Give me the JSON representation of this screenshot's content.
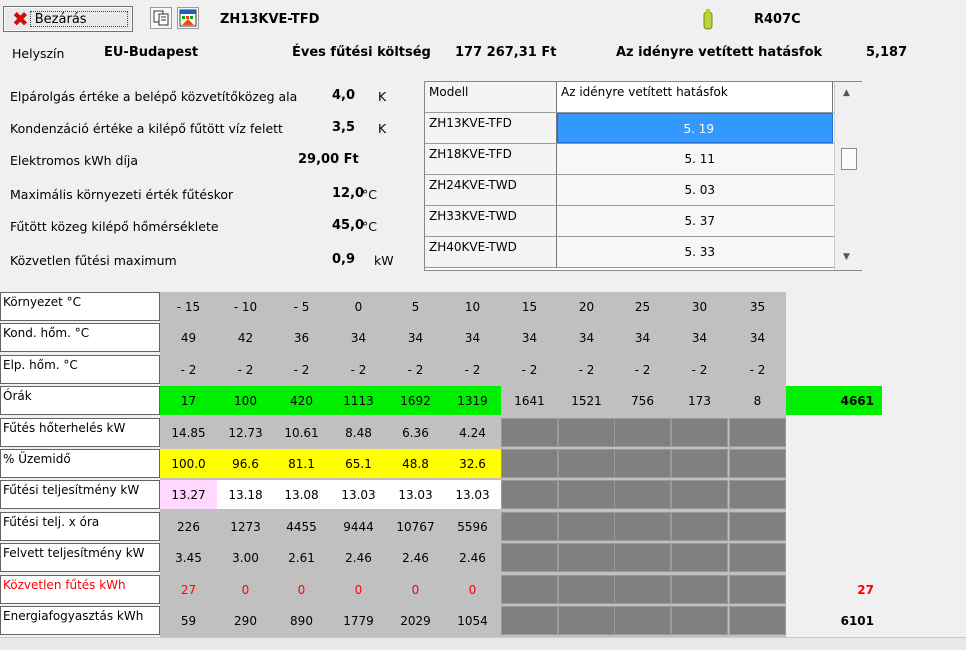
{
  "toolbar": {
    "close_label": "Bezárás",
    "copy_icon": "copy-icon",
    "report_icon": "chart-report-icon",
    "model": "ZH13KVE-TFD",
    "refrigerant_icon": "refrigerant-bottle-icon",
    "refrigerant": "R407C"
  },
  "info": {
    "location_label": "Helyszín",
    "location_value": "EU-Budapest",
    "cost_label": "Éves fűtési költség",
    "cost_value": "177 267,31 Ft",
    "scop_label": "Az idényre vetített hatásfok",
    "scop_value": "5,187"
  },
  "params": [
    {
      "label": "Elpárolgás értéke a belépő közvetítőközeg ala",
      "value": "4,0",
      "unit": "K"
    },
    {
      "label": "Kondenzáció értéke a kilépő fűtött víz felett",
      "value": "3,5",
      "unit": "K"
    },
    {
      "label": "Elektromos kWh díja",
      "value": "29,00 Ft",
      "unit": ""
    },
    {
      "label": "Maximális környezeti érték fűtéskor",
      "value": "12,0",
      "unit": "°C"
    },
    {
      "label": "Fűtött közeg kilépő hőmérséklete",
      "value": "45,0",
      "unit": "°C"
    },
    {
      "label": "Közvetlen fűtési maximum",
      "value": "0,9",
      "unit": "kW"
    }
  ],
  "model_list": {
    "col_model": "Modell",
    "col_scop": "Az idényre vetített hatásfok",
    "rows": [
      {
        "model": "ZH13KVE-TFD",
        "scop": "5. 19"
      },
      {
        "model": "ZH18KVE-TFD",
        "scop": "5. 11"
      },
      {
        "model": "ZH24KVE-TWD",
        "scop": "5. 03"
      },
      {
        "model": "ZH33KVE-TWD",
        "scop": "5. 37"
      },
      {
        "model": "ZH40KVE-TWD",
        "scop": "5. 33"
      }
    ],
    "selected_index": 0
  },
  "table": {
    "rows": [
      {
        "label": "Környezet °C",
        "style": "plain",
        "cells": [
          "- 15",
          "- 10",
          "- 5",
          "0",
          "5",
          "10",
          "15",
          "20",
          "25",
          "30",
          "35"
        ],
        "total": ""
      },
      {
        "label": "Kond. hőm. °C",
        "style": "plain",
        "cells": [
          "49",
          "42",
          "36",
          "34",
          "34",
          "34",
          "34",
          "34",
          "34",
          "34",
          "34"
        ],
        "total": ""
      },
      {
        "label": "Elp. hőm. °C",
        "style": "plain",
        "cells": [
          "- 2",
          "- 2",
          "- 2",
          "- 2",
          "- 2",
          "- 2",
          "- 2",
          "- 2",
          "- 2",
          "- 2",
          "- 2"
        ],
        "total": ""
      },
      {
        "label": "Órák",
        "style": "green",
        "cells": [
          "17",
          "100",
          "420",
          "1113",
          "1692",
          "1319",
          "1641",
          "1521",
          "756",
          "173",
          "8"
        ],
        "total": "4661"
      },
      {
        "label": "Fűtés hőterhelés kW",
        "style": "plain",
        "cells": [
          "14.85",
          "12.73",
          "10.61",
          "8.48",
          "6.36",
          "4.24",
          "",
          "",
          "",
          "",
          ""
        ],
        "total": ""
      },
      {
        "label": "% Üzemidő",
        "style": "yellow",
        "cells": [
          "100.0",
          "96.6",
          "81.1",
          "65.1",
          "48.8",
          "32.6",
          "",
          "",
          "",
          "",
          ""
        ],
        "total": ""
      },
      {
        "label": "Fűtési teljesítmény kW",
        "style": "white",
        "cells": [
          "13.27",
          "13.18",
          "13.08",
          "13.03",
          "13.03",
          "13.03",
          "",
          "",
          "",
          "",
          ""
        ],
        "total": ""
      },
      {
        "label": "Fűtési telj. x óra",
        "style": "plain",
        "cells": [
          "226",
          "1273",
          "4455",
          "9444",
          "10767",
          "5596",
          "",
          "",
          "",
          "",
          ""
        ],
        "total": ""
      },
      {
        "label": "Felvett teljesítmény kW",
        "style": "plain",
        "cells": [
          "3.45",
          "3.00",
          "2.61",
          "2.46",
          "2.46",
          "2.46",
          "",
          "",
          "",
          "",
          ""
        ],
        "total": ""
      },
      {
        "label": "Közvetlen fűtés kWh",
        "style": "red",
        "cells": [
          "27",
          "0",
          "0",
          "0",
          "0",
          "0",
          "",
          "",
          "",
          "",
          ""
        ],
        "total": "27"
      },
      {
        "label": "Energiafogyasztás kWh",
        "style": "plain",
        "cells": [
          "59",
          "290",
          "890",
          "1779",
          "2029",
          "1054",
          "",
          "",
          "",
          "",
          ""
        ],
        "total": "6101"
      }
    ]
  },
  "colors": {
    "green": "#00ee00",
    "yellow": "#ffff00",
    "pink": "#ffd7ff",
    "red": "#ff0000",
    "selection": "#3399ff"
  }
}
